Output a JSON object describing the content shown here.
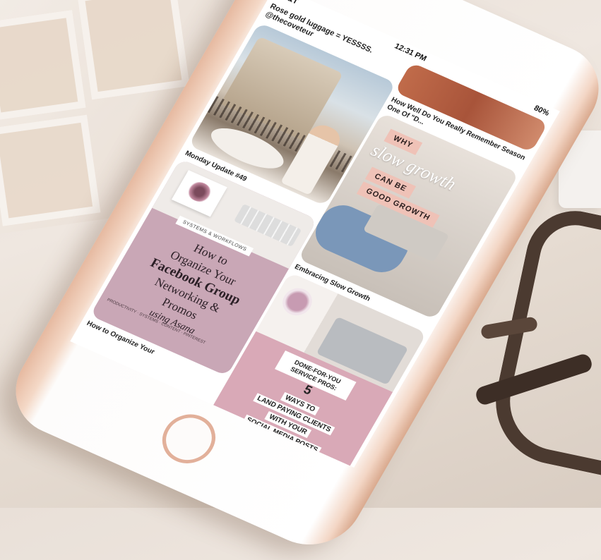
{
  "status_bar": {
    "carrier": "AT&T",
    "time": "12:31 PM",
    "battery": "80%"
  },
  "pins_left": [
    {
      "title": "Rose gold luggage = YESSSS. @thecoveteur",
      "image": "paris-balcony-photo",
      "caption": "Monday Update #49"
    },
    {
      "image": "organize-facebook-group-graphic",
      "tag": "SYSTEMS & WORKFLOWS",
      "lines": [
        "How to",
        "Organize Your",
        "Facebook Group",
        "Networking &",
        "Promos",
        "using Asana"
      ],
      "footer": "PRODUCTIVITY · SYSTEMS · CONTENT · PINTEREST",
      "caption": "How to Organize Your"
    }
  ],
  "pins_right": [
    {
      "image": "fashion-photo-cropped",
      "caption": "How Well Do You Really Remember Season One Of \"D..."
    },
    {
      "image": "slow-growth-graphic",
      "lines": [
        "WHY",
        "slow growth",
        "CAN BE",
        "GOOD GROWTH"
      ],
      "caption": "Embracing Slow Growth"
    },
    {
      "image": "service-pros-graphic",
      "lines": [
        "DONE-FOR-YOU SERVICE PROS:",
        "5",
        "WAYS TO",
        "LAND PAYING CLIENTS",
        "WITH YOUR",
        "SOCIAL MEDIA POSTS"
      ]
    }
  ],
  "colors": {
    "accent_pink": "#d9a9b7",
    "rose_gold": "#e2b09a",
    "mauve": "#c9a7b6"
  }
}
